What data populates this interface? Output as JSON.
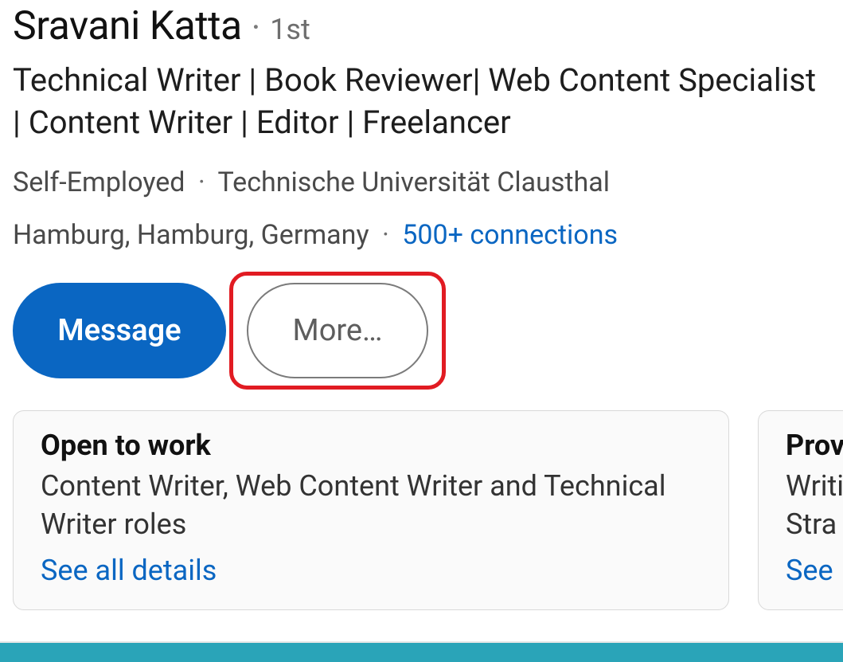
{
  "profile": {
    "name": "Sravani Katta",
    "degree": "1st",
    "headline": "Technical Writer | Book Reviewer| Web Content Specialist | Content Writer | Editor | Freelancer",
    "company": "Self-Employed",
    "education": "Technische Universität Clausthal",
    "location": "Hamburg, Hamburg, Germany",
    "connections": "500+ connections"
  },
  "actions": {
    "message": "Message",
    "more": "More…"
  },
  "cards": [
    {
      "title": "Open to work",
      "body": "Content Writer, Web Content Writer and Technical Writer roles",
      "link": "See all details"
    },
    {
      "title": "Prov",
      "body": "Writi\nStra",
      "link": "See"
    }
  ]
}
